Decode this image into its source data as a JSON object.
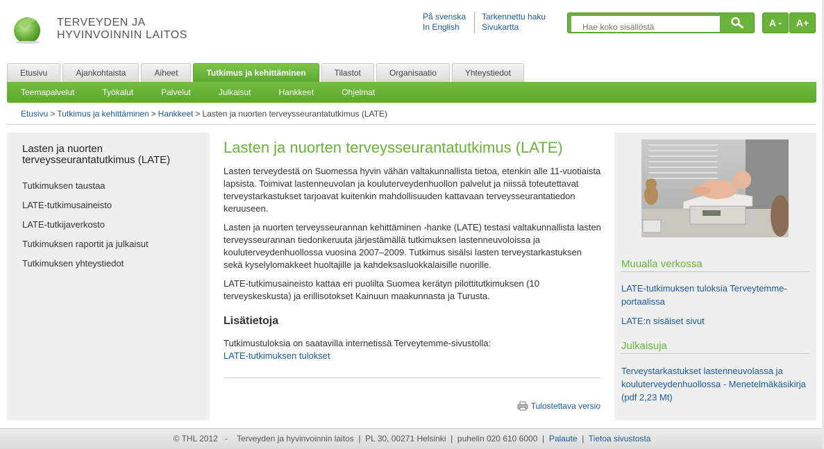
{
  "header": {
    "logo_line1": "TERVEYDEN JA",
    "logo_line2": "HYVINVOINNIN LAITOS",
    "lang_swedish": "På svenska",
    "lang_english": "In English",
    "advanced_search": "Tarkennettu haku",
    "sitemap": "Sivukartta",
    "search_placeholder": "Hae koko sisällöstä",
    "font_smaller": "A -",
    "font_larger": "A+"
  },
  "tabs": [
    {
      "label": "Etusivu"
    },
    {
      "label": "Ajankohtaista"
    },
    {
      "label": "Aiheet"
    },
    {
      "label": "Tutkimus ja kehittäminen",
      "active": true
    },
    {
      "label": "Tilastot"
    },
    {
      "label": "Organisaatio"
    },
    {
      "label": "Yhteystiedot"
    }
  ],
  "subnav": [
    "Teemapalvelut",
    "Työkalut",
    "Palvelut",
    "Julkaisut",
    "Hankkeet",
    "Ohjelmat"
  ],
  "breadcrumb": {
    "home": "Etusivu",
    "section": "Tutkimus ja kehittäminen",
    "projects": "Hankkeet",
    "current": "Lasten ja nuorten terveysseurantatutkimus (LATE)"
  },
  "left": {
    "title": "Lasten ja nuorten terveysseurantatutkimus (LATE)",
    "items": [
      "Tutkimuksen taustaa",
      "LATE-tutkimusaineisto",
      "LATE-tutkijaverkosto",
      "Tutkimuksen raportit ja julkaisut",
      "Tutkimuksen yhteystiedot"
    ]
  },
  "main": {
    "title": "Lasten ja nuorten terveysseurantatutkimus (LATE)",
    "p1": "Lasten terveydestä on Suomessa hyvin vähän valtakunnallista tietoa, etenkin alle 11-vuotiaista lapsista. Toimivat lastenneuvolan ja kouluterveydenhuollon palvelut ja niissä toteutettavat terveystarkastukset tarjoavat kuitenkin mahdollisuuden kattavaan terveysseurantatiedon keruuseen.",
    "p2": "Lasten ja nuorten terveysseurannan kehittäminen -hanke (LATE) testasi valtakunnallista lasten terveysseurannan tiedonkeruuta järjestämällä tutkimuksen lastenneuvoloissa ja kouluterveydenhuollossa vuosina 2007–2009. Tutkimus sisälsi lasten terveystarkastuksen sekä kyselylomakkeet huoltajille ja kahdeksasluokkalaisille nuorille.",
    "p3": "LATE-tutkimusaineisto kattaa eri puolilta Suomea kerätyn pilottitutkimuksen (10 terveyskeskusta) ja erillisotokset Kainuun maakunnasta ja Turusta.",
    "more_heading": "Lisätietoja",
    "p4": "Tutkimustuloksia on saatavilla internetissä Terveytemme-sivustolla:",
    "results_link": "LATE-tutkimuksen tulokset",
    "print_link": "Tulostettava versio"
  },
  "right": {
    "elsewhere_heading": "Muualla verkossa",
    "link1": "LATE-tutkimuksen tuloksia Terveytemme-portaalissa",
    "link2": "LATE:n sisäiset sivut",
    "publications_heading": "Julkaisuja",
    "pub1": "Terveystarkastukset lastenneuvolassa ja kouluterveydenhuollossa - Menetelmäkäsikirja (pdf 2,23 Mt)"
  },
  "footer": {
    "copyright": "© THL 2012",
    "org": "Terveyden ja hyvinvoinnin laitos",
    "address": "PL 30, 00271 Helsinki",
    "phone": "puhelin 020 610 6000",
    "feedback": "Palaute",
    "about": "Tietoa sivustosta"
  },
  "colors": {
    "brand_green": "#6ab33a",
    "link_blue": "#1a5a9a"
  }
}
